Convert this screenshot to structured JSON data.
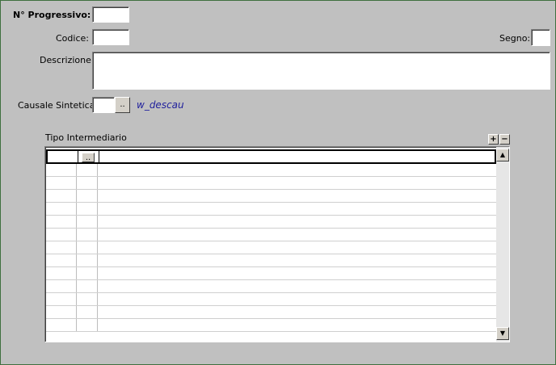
{
  "form": {
    "progressivo_label": "N° Progressivo:",
    "codice_label": "Codice:",
    "segno_label": "Segno:",
    "descrizione_label": "Descrizione:",
    "causale_label": "Causale Sintetica:",
    "lookup_button": "..",
    "causale_desc": "w_descau"
  },
  "grid": {
    "title": "Tipo Intermediario",
    "add_button": "+",
    "remove_button": "−",
    "row_lookup_button": "..",
    "scroll_up": "▲",
    "scroll_down": "▼"
  }
}
